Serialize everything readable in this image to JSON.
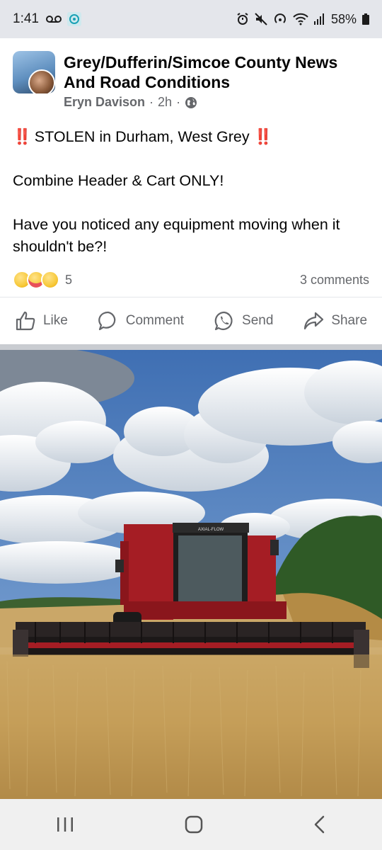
{
  "status_bar": {
    "time": "1:41",
    "battery": "58%"
  },
  "post": {
    "group_name": "Grey/Dufferin/Simcoe County News And Road Conditions",
    "author": "Eryn Davison",
    "time_ago": "2h",
    "separator": "·",
    "privacy_icon": "globe-icon",
    "alert_mark": "‼️",
    "headline": "STOLEN in Durham, West Grey",
    "line2": "Combine Header & Cart ONLY!",
    "line3": "Have you noticed any equipment moving when it shouldn't be?!",
    "reactions": {
      "types": [
        "sad",
        "care",
        "wow"
      ],
      "count": "5"
    },
    "comments": "3 comments"
  },
  "actions": {
    "like": "Like",
    "comment": "Comment",
    "send": "Send",
    "share": "Share"
  },
  "photo": {
    "machine_badge": "AXIAL-FLOW"
  },
  "colors": {
    "accent_red": "#e41e3f",
    "muted_text": "#65676b",
    "combine_red": "#a51d24"
  }
}
